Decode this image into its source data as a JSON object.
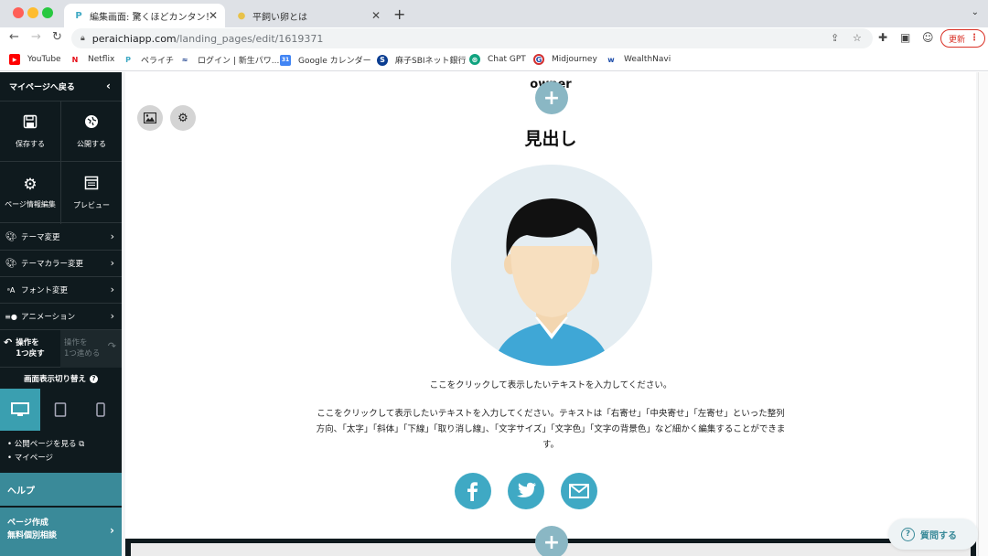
{
  "browser": {
    "tabs": [
      {
        "title": "編集画面: 驚くほどカンタン！無料",
        "favicon": "P"
      },
      {
        "title": "平飼い卵とは",
        "favicon": "egg"
      }
    ],
    "url_domain": "peraichiapp.com",
    "url_path": "/landing_pages/edit/1619371",
    "update_label": "更新",
    "bookmarks": [
      {
        "label": "YouTube",
        "color": "#ff0000",
        "glyph": "▶"
      },
      {
        "label": "Netflix",
        "color": "#e50914",
        "glyph": "N"
      },
      {
        "label": "ペライチ",
        "color": "#3fa9c4",
        "glyph": "P"
      },
      {
        "label": "ログイン | 新生パワ...",
        "color": "#1a3e8c",
        "glyph": "≈"
      },
      {
        "label": "Google カレンダー",
        "color": "#4285f4",
        "glyph": "31"
      },
      {
        "label": "麻子SBIネット銀行",
        "color": "#0a3d91",
        "glyph": "S"
      },
      {
        "label": "Chat GPT",
        "color": "#10a37f",
        "glyph": "⊛"
      },
      {
        "label": "Midjourney",
        "color": "#d32f2f",
        "glyph": "G"
      },
      {
        "label": "WealthNavi",
        "color": "#1a4aa8",
        "glyph": "W"
      }
    ]
  },
  "sidebar": {
    "back_label": "マイページへ戻る",
    "tiles": [
      {
        "label": "保存する",
        "icon": "save-icon"
      },
      {
        "label": "公開する",
        "icon": "publish-icon"
      },
      {
        "label": "ページ情報編集",
        "icon": "gear-icon"
      },
      {
        "label": "プレビュー",
        "icon": "preview-icon"
      }
    ],
    "menu": [
      {
        "label": "テーマ変更",
        "icon": "palette-icon"
      },
      {
        "label": "テーマカラー変更",
        "icon": "palette-icon"
      },
      {
        "label": "フォント変更",
        "icon": "font-icon"
      },
      {
        "label": "アニメーション",
        "icon": "animation-icon"
      }
    ],
    "undo_line1": "操作を",
    "undo_line2": "1つ戻す",
    "redo_line1": "操作を",
    "redo_line2": "1つ進める",
    "view_title": "画面表示切り替え",
    "links": [
      "公開ページを見る",
      "マイページ"
    ],
    "help_label": "ヘルプ",
    "consult_line1": "ページ作成",
    "consult_line2": "無料個別相談"
  },
  "content": {
    "owner_label": "owner",
    "heading": "見出し",
    "paragraph1": "ここをクリックして表示したいテキストを入力してください。",
    "paragraph2": "ここをクリックして表示したいテキストを入力してください。テキストは「右寄せ」「中央寄せ」「左寄せ」といった整列方向、「太字」「斜体」「下線」「取り消し線」、「文字サイズ」「文字色」「文字の背景色」など細かく編集することができます。",
    "social_icons": [
      "facebook-icon",
      "twitter-icon",
      "mail-icon"
    ],
    "help_button": "質問する"
  },
  "colors": {
    "sidebar_bg": "#0f1a1e",
    "accent": "#3a8a99",
    "social": "#3fa9c4"
  }
}
